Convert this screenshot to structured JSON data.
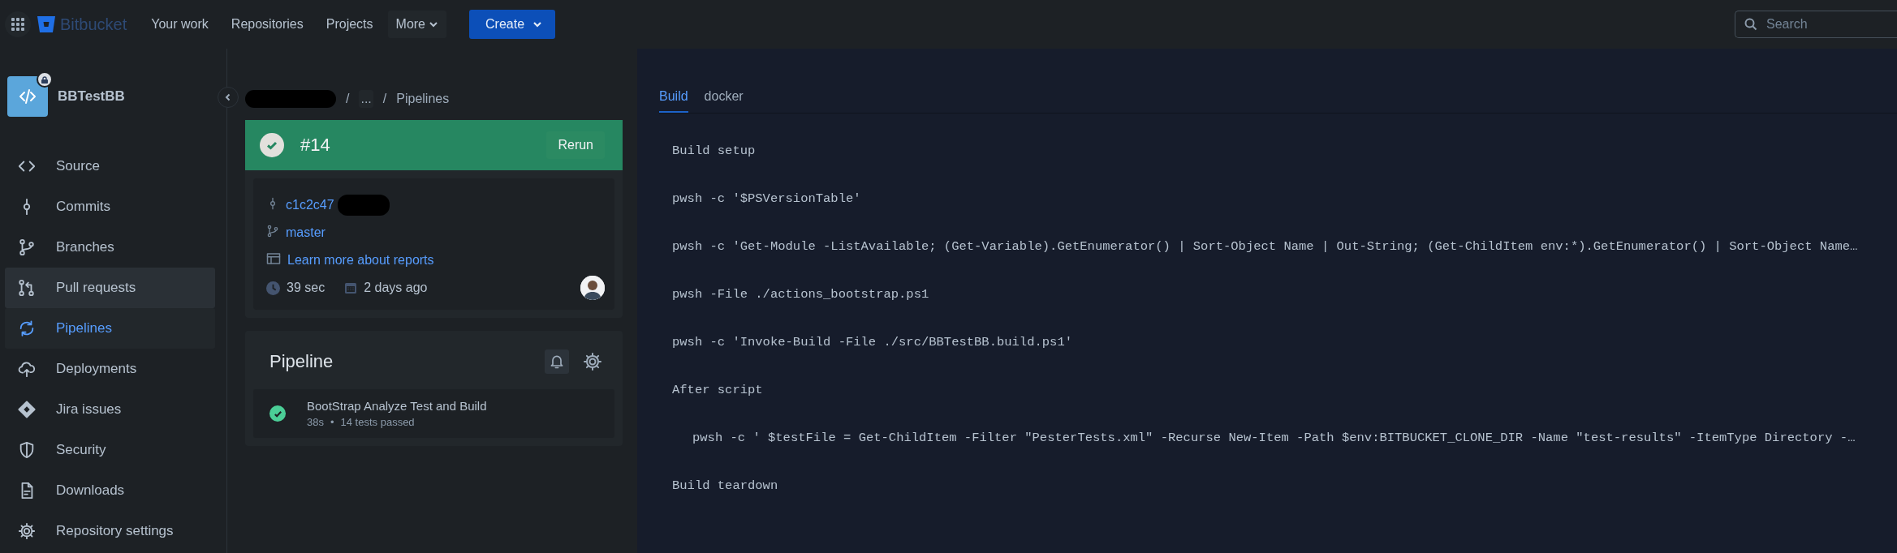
{
  "topbar": {
    "product": "Bitbucket",
    "nav": [
      {
        "label": "Your work"
      },
      {
        "label": "Repositories"
      },
      {
        "label": "Projects"
      }
    ],
    "more": "More",
    "create": "Create",
    "search": {
      "placeholder": "Search"
    }
  },
  "repo": {
    "name": "BBTestBB",
    "private": true
  },
  "sidebar": {
    "items": [
      {
        "label": "Source",
        "selected": false,
        "hovered": false
      },
      {
        "label": "Commits",
        "selected": false,
        "hovered": false
      },
      {
        "label": "Branches",
        "selected": false,
        "hovered": false
      },
      {
        "label": "Pull requests",
        "selected": false,
        "hovered": true
      },
      {
        "label": "Pipelines",
        "selected": true,
        "hovered": false
      },
      {
        "label": "Deployments",
        "selected": false,
        "hovered": false
      },
      {
        "label": "Jira issues",
        "selected": false,
        "hovered": false
      },
      {
        "label": "Security",
        "selected": false,
        "hovered": false
      },
      {
        "label": "Downloads",
        "selected": false,
        "hovered": false
      },
      {
        "label": "Repository settings",
        "selected": false,
        "hovered": false
      }
    ]
  },
  "breadcrumb": [
    {
      "separator": "/",
      "label": "..."
    },
    {
      "separator": "/",
      "label": "Pipelines"
    }
  ],
  "run": {
    "number": "#14",
    "success": true,
    "rerun": "Rerun",
    "commit": "c1c2c47",
    "branch": "master",
    "reports_link": "Learn more about reports",
    "duration": "39 sec",
    "when": "2 days ago"
  },
  "pipeline": {
    "title": "Pipeline",
    "steps": [
      {
        "name": "BootStrap Analyze Test and Build",
        "success": true,
        "duration": "38s",
        "separator": "•",
        "tests": "14 tests passed"
      }
    ]
  },
  "log": {
    "tabs": [
      {
        "label": "Build",
        "selected": true
      },
      {
        "label": "docker",
        "selected": false
      }
    ],
    "lines": [
      {
        "kind": "section",
        "text": "Build setup"
      },
      {
        "kind": "command",
        "text": "pwsh -c '$PSVersionTable'"
      },
      {
        "kind": "command",
        "text": "pwsh -c 'Get-Module -ListAvailable; (Get-Variable).GetEnumerator() | Sort-Object Name | Out-String; (Get-ChildItem env:*).GetEnumerator() | Sort-Object Name…"
      },
      {
        "kind": "command",
        "text": "pwsh -File ./actions_bootstrap.ps1"
      },
      {
        "kind": "command",
        "text": "pwsh -c 'Invoke-Build -File ./src/BBTestBB.build.ps1'"
      },
      {
        "kind": "section",
        "text": "After script"
      },
      {
        "kind": "nested_command",
        "text": "pwsh -c ' $testFile = Get-ChildItem -Filter \"PesterTests.xml\" -Recurse New-Item -Path $env:BITBUCKET_CLONE_DIR -Name \"test-results\" -ItemType Directory -…"
      },
      {
        "kind": "section",
        "text": "Build teardown"
      }
    ]
  }
}
